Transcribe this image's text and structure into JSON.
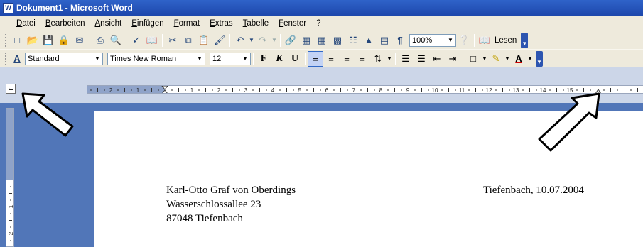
{
  "window": {
    "title": "Dokument1 - Microsoft Word",
    "app_icon_glyph": "W"
  },
  "menu": [
    "Datei",
    "Bearbeiten",
    "Ansicht",
    "Einfügen",
    "Format",
    "Extras",
    "Tabelle",
    "Fenster",
    "?"
  ],
  "toolbar_standard": {
    "zoom_value": "100%",
    "read_label": "Lesen"
  },
  "toolbar_format": {
    "style_value": "Standard",
    "font_value": "Times New Roman",
    "size_value": "12",
    "bold_label": "F",
    "italic_label": "K",
    "underline_label": "U"
  },
  "ruler": {
    "h_labels": [
      "2",
      "1",
      "1",
      "2",
      "3",
      "4",
      "5",
      "6",
      "7",
      "8",
      "9",
      "10",
      "11",
      "12",
      "13",
      "14",
      "15"
    ],
    "v_labels": [
      "2",
      "1",
      "1",
      "2"
    ]
  },
  "document": {
    "sender_line1": "Karl-Otto Graf von Oberdings",
    "sender_line2": "Wasserschlossallee 23",
    "sender_line3": "87048 Tiefenbach",
    "date_line": "Tiefenbach, 10.07.2004"
  },
  "colors": {
    "titlebar": "#1d47ac",
    "toolbar_bg": "#eeeadc",
    "doc_bg": "#5176b8"
  }
}
